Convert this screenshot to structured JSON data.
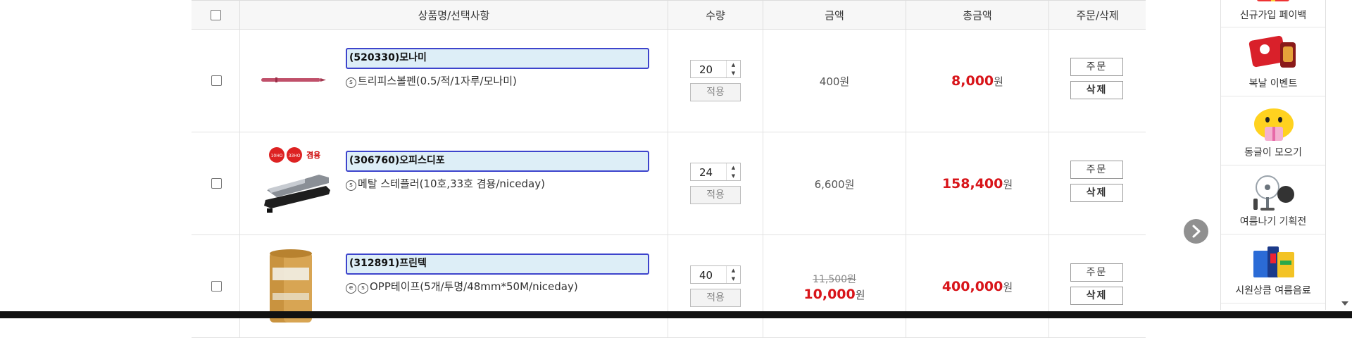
{
  "header": {
    "product_col": "상품명/선택사항",
    "qty_col": "수량",
    "price_col": "금액",
    "total_col": "총금액",
    "action_col": "주문/삭제"
  },
  "rows": [
    {
      "product_name": "(520330)모나미",
      "desc": "트리피스볼펜(0.5/적/1자루/모나미)",
      "badges": [
        "s"
      ],
      "qty": "20",
      "apply": "적용",
      "price": "400원",
      "total": "8,000",
      "won": "원",
      "order": "주문",
      "delete": "삭제",
      "thumb_icon": "red-pen-image"
    },
    {
      "product_name": "(306760)오피스디포",
      "desc": "메탈 스테플러(10호,33호 겸용/niceday)",
      "badges": [
        "s"
      ],
      "qty": "24",
      "apply": "적용",
      "price": "6,600원",
      "total": "158,400",
      "won": "원",
      "order": "주문",
      "delete": "삭제",
      "thumb_icon": "stapler-image",
      "thumb_labels": [
        "10HO",
        "33HO",
        "겸용"
      ]
    },
    {
      "product_name": "(312891)프린텍",
      "desc": "OPP테이프(5개/투명/48mm*50M/niceday)",
      "badges": [
        "e",
        "s"
      ],
      "qty": "40",
      "apply": "적용",
      "price_original": "11,500원",
      "price_sale": "10,000",
      "won": "원",
      "total": "400,000",
      "order": "주문",
      "delete": "삭제",
      "thumb_icon": "tape-rolls-image"
    }
  ],
  "sidebar": {
    "items": [
      {
        "label": "신규가입 페이백",
        "icon": "gift-box-icon"
      },
      {
        "label": "복날 이벤트",
        "icon": "red-cards-icon"
      },
      {
        "label": "동글이 모으기",
        "icon": "yellow-character-icon"
      },
      {
        "label": "여름나기 기획전",
        "icon": "fan-icon"
      },
      {
        "label": "시원상큼 여름음료",
        "icon": "drinks-icon"
      }
    ]
  },
  "colors": {
    "accent_red": "#d8151a",
    "highlight_border": "#3d44cc",
    "highlight_bg": "#ddeef7"
  }
}
